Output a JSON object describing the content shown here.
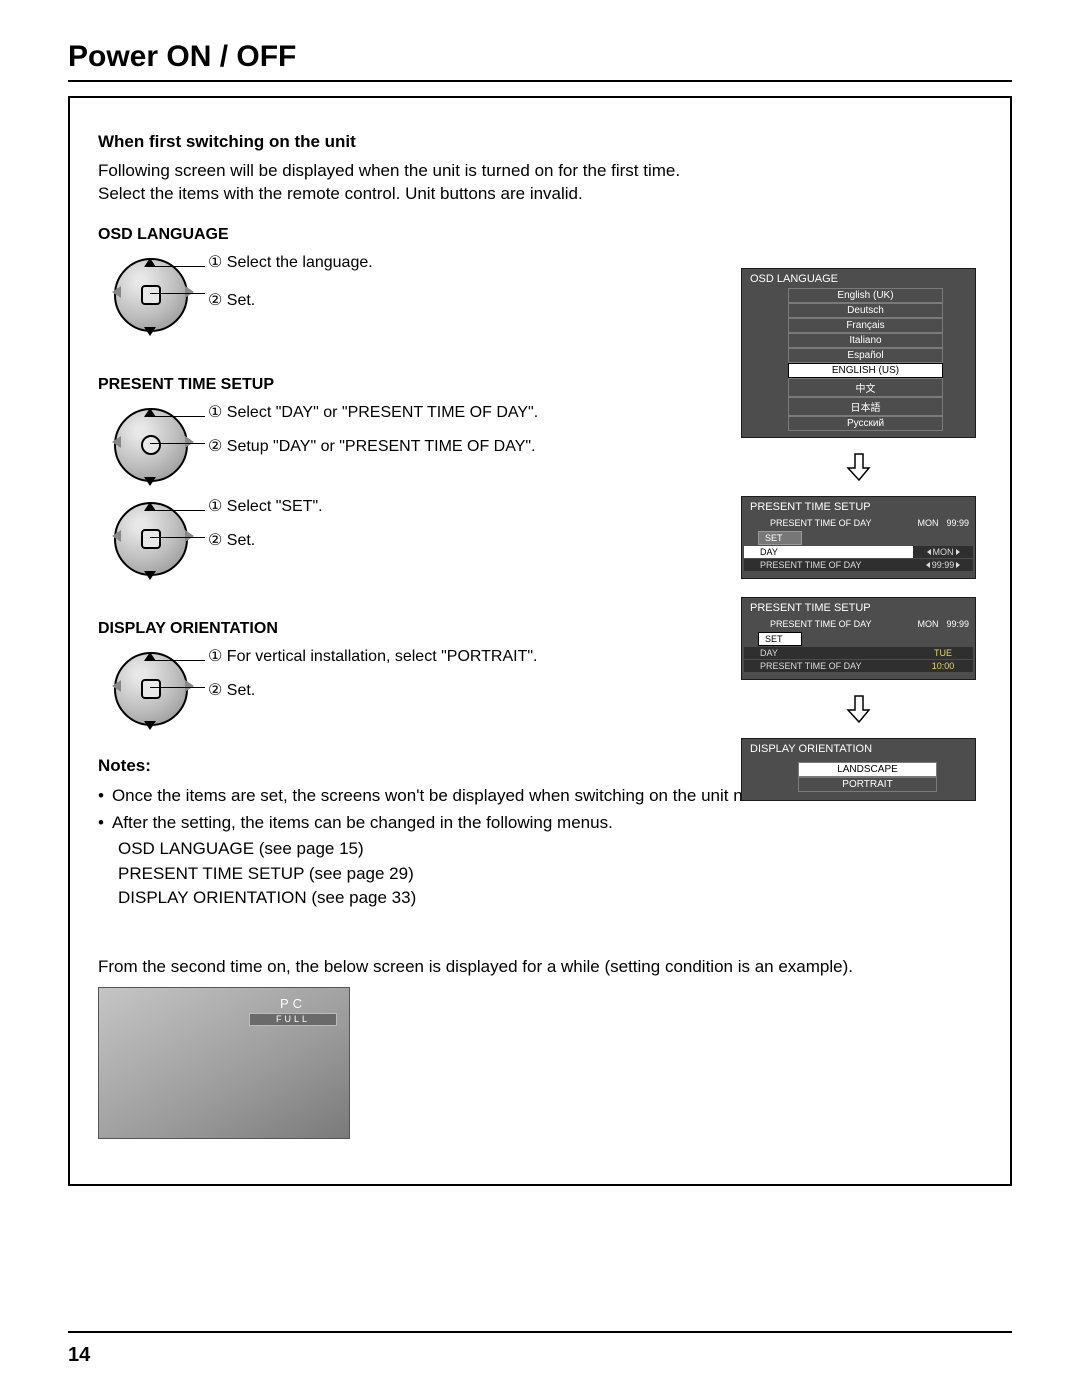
{
  "page": {
    "title": "Power ON / OFF",
    "number": "14"
  },
  "first_switch": {
    "heading": "When first switching on the unit",
    "para1": "Following screen will be displayed when the unit is turned on for the first time.",
    "para2": "Select the items with the remote control. Unit buttons are invalid."
  },
  "osd_lang": {
    "heading": "OSD LANGUAGE",
    "step1": "① Select the language.",
    "step2": "② Set."
  },
  "pts": {
    "heading": "PRESENT TIME SETUP",
    "step1": "① Select \"DAY\" or \"PRESENT TIME OF DAY\".",
    "step2": "② Setup \"DAY\" or \"PRESENT TIME OF DAY\".",
    "step3": "① Select \"SET\".",
    "step4": "② Set."
  },
  "disp_ori": {
    "heading": "DISPLAY ORIENTATION",
    "step1": "① For vertical installation, select \"PORTRAIT\".",
    "step2": "② Set."
  },
  "notes": {
    "label": "Notes:",
    "b1": "Once the items are set, the screens won't be displayed when switching on the unit next time.",
    "b2": "After the setting, the items can be changed in the following menus.",
    "s1": "OSD LANGUAGE (see page 15)",
    "s2": "PRESENT TIME SETUP (see page 29)",
    "s3": "DISPLAY ORIENTATION (see page 33)"
  },
  "second_para": "From the second time on, the below screen is displayed for a while (setting condition is an example).",
  "startup": {
    "pc": "PC",
    "full": "FULL"
  },
  "osd_menu": {
    "lang_title": "OSD LANGUAGE",
    "languages": [
      "English (UK)",
      "Deutsch",
      "Français",
      "Italiano",
      "Español",
      "ENGLISH (US)",
      "中文",
      "日本語",
      "Русский"
    ],
    "selected_index": 5,
    "pts_title": "PRESENT TIME SETUP",
    "pts1": {
      "header_label": "PRESENT TIME OF DAY",
      "header_day": "MON",
      "header_time": "99:99",
      "set": "SET",
      "day_label": "DAY",
      "day_val": "MON",
      "time_label": "PRESENT TIME OF DAY",
      "time_val": "99:99"
    },
    "pts2": {
      "header_label": "PRESENT TIME OF DAY",
      "header_day": "MON",
      "header_time": "99:99",
      "set": "SET",
      "day_label": "DAY",
      "day_val": "TUE",
      "time_label": "PRESENT TIME OF DAY",
      "time_val": "10:00"
    },
    "ori_title": "DISPLAY ORIENTATION",
    "ori_items": [
      "LANDSCAPE",
      "PORTRAIT"
    ],
    "ori_selected": 0
  }
}
